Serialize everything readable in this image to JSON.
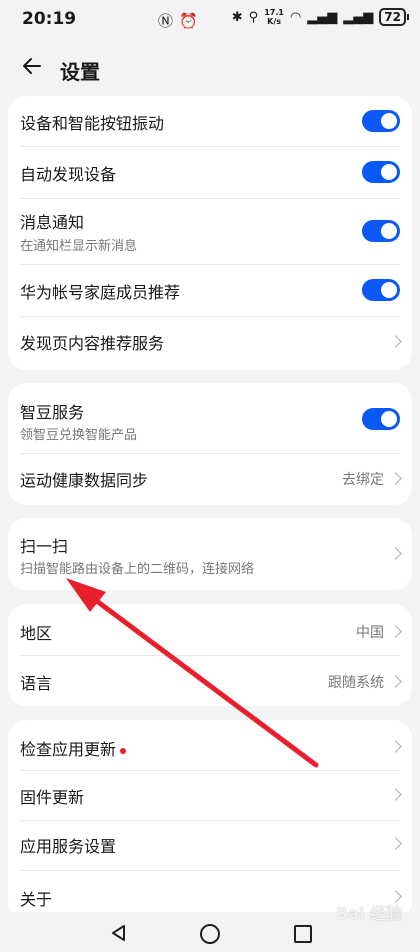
{
  "status_bar": {
    "time": "20:19",
    "net_speed_value": "17.1",
    "net_speed_unit": "K/s",
    "battery": "72"
  },
  "header": {
    "title": "设置"
  },
  "cards": [
    {
      "rows": [
        {
          "label": "设备和智能按钮振动",
          "sublabel": "",
          "toggle": true
        },
        {
          "label": "自动发现设备",
          "sublabel": "",
          "toggle": true
        },
        {
          "label": "消息通知",
          "sublabel": "在通知栏显示新消息",
          "toggle": true
        },
        {
          "label": "华为帐号家庭成员推荐",
          "sublabel": "",
          "toggle": true
        },
        {
          "label": "发现页内容推荐服务",
          "sublabel": "",
          "toggle": false
        }
      ]
    },
    {
      "rows": [
        {
          "label": "智豆服务",
          "sublabel": "领智豆兑换智能产品",
          "toggle": true
        },
        {
          "label": "运动健康数据同步",
          "value": "去绑定"
        }
      ]
    },
    {
      "rows": [
        {
          "label": "扫一扫",
          "sublabel": "扫描智能路由设备上的二维码，连接网络"
        }
      ]
    },
    {
      "rows": [
        {
          "label": "地区",
          "value": "中国"
        },
        {
          "label": "语言",
          "value": "跟随系统"
        }
      ]
    },
    {
      "rows": [
        {
          "label": "检查应用更新",
          "badge": "red-dot"
        },
        {
          "label": "固件更新"
        },
        {
          "label": "应用服务设置"
        },
        {
          "label": "关于"
        }
      ]
    }
  ],
  "watermark": "Bai 经验",
  "colors": {
    "accent": "#0a59f7",
    "annotation_arrow": "#e8202c",
    "badge": "#e8202c",
    "background": "#f1f3f5"
  }
}
